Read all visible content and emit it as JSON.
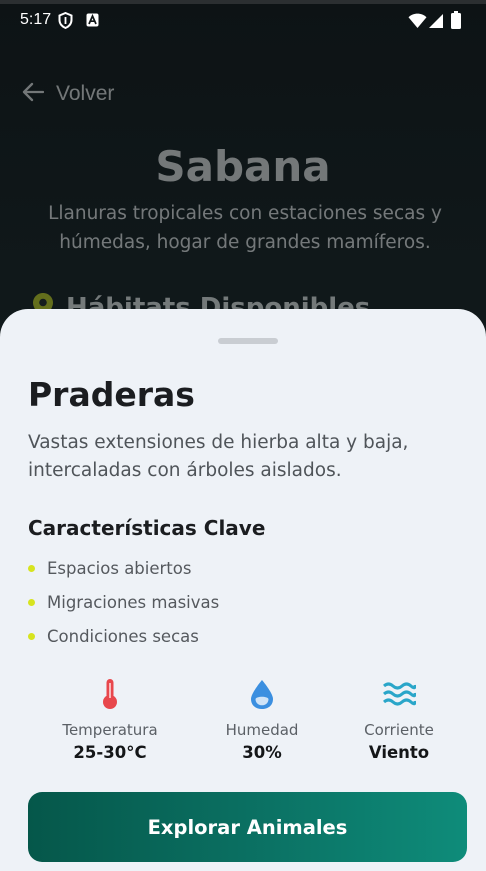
{
  "status_bar": {
    "time": "5:17"
  },
  "header": {
    "back_label": "Volver",
    "title": "Sabana",
    "subtitle": "Llanuras tropicales con estaciones secas y húmedas, hogar de grandes mamíferos.",
    "section_title": "Hábitats Disponibles"
  },
  "sheet": {
    "title": "Praderas",
    "description": "Vastas extensiones de hierba alta y baja, intercaladas con árboles aislados.",
    "features_title": "Características Clave",
    "features": [
      "Espacios abiertos",
      "Migraciones masivas",
      "Condiciones secas"
    ],
    "stats": [
      {
        "label": "Temperatura",
        "value": "25-30°C",
        "icon": "thermometer-icon"
      },
      {
        "label": "Humedad",
        "value": "30%",
        "icon": "water-drop-icon"
      },
      {
        "label": "Corriente",
        "value": "Viento",
        "icon": "waves-icon"
      }
    ],
    "cta_label": "Explorar Animales"
  },
  "colors": {
    "accent": "#0b7264",
    "bullet": "#d7e41f",
    "temperature_icon": "#e8474c",
    "humidity_icon": "#3b8fe0",
    "current_icon": "#2aa6c9"
  }
}
